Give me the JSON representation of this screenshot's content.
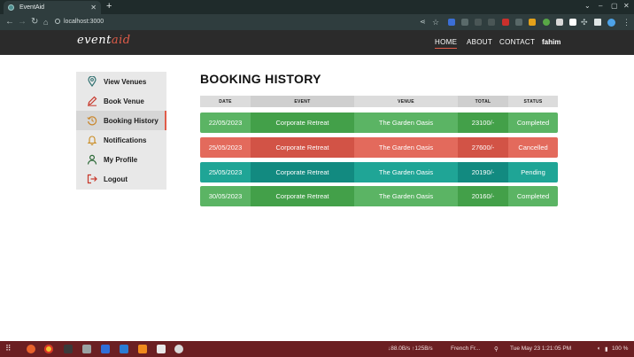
{
  "browser": {
    "tab_title": "EventAid",
    "tab_close": "✕",
    "new_tab": "+",
    "url": "localhost:3000",
    "window_controls": [
      "⌄",
      "–",
      "▢",
      "✕"
    ]
  },
  "site": {
    "logo_part1": "event",
    "logo_part2": "aid",
    "nav": [
      "HOME",
      "ABOUT",
      "CONTACT",
      "fahim"
    ],
    "accent_color": "#e05c49"
  },
  "sidebar": {
    "items": [
      {
        "label": "View Venues",
        "icon": "map-pin-icon"
      },
      {
        "label": "Book Venue",
        "icon": "pencil-icon"
      },
      {
        "label": "Booking History",
        "icon": "history-icon"
      },
      {
        "label": "Notifications",
        "icon": "bell-icon"
      },
      {
        "label": "My Profile",
        "icon": "user-icon"
      },
      {
        "label": "Logout",
        "icon": "logout-icon"
      }
    ]
  },
  "main": {
    "title": "BOOKING HISTORY",
    "columns": [
      "DATE",
      "EVENT",
      "VENUE",
      "TOTAL",
      "STATUS"
    ],
    "rows": [
      {
        "date": "22/05/2023",
        "event": "Corporate Retreat",
        "venue": "The Garden Oasis",
        "total": "23100/-",
        "status": "Completed"
      },
      {
        "date": "25/05/2023",
        "event": "Corporate Retreat",
        "venue": "The Garden Oasis",
        "total": "27600/-",
        "status": "Cancelled"
      },
      {
        "date": "25/05/2023",
        "event": "Corporate Retreat",
        "venue": "The Garden Oasis",
        "total": "20190/-",
        "status": "Pending"
      },
      {
        "date": "30/05/2023",
        "event": "Corporate Retreat",
        "venue": "The Garden Oasis",
        "total": "20160/-",
        "status": "Completed"
      }
    ],
    "status_colors": {
      "Completed": "#43a049",
      "Cancelled": "#d25346",
      "Pending": "#128a80"
    }
  },
  "taskbar": {
    "network": "↓88.0B/s ↑125B/s",
    "keyboard": "French Fr...",
    "datetime": "Tue May 23   1:21:05 PM",
    "battery": "100 %"
  }
}
